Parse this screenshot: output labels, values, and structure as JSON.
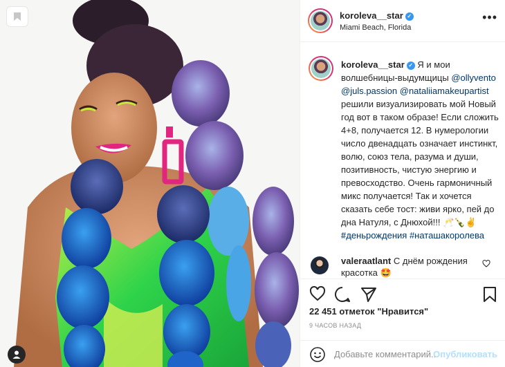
{
  "post": {
    "username": "koroleva__star",
    "location": "Miami Beach, Florida",
    "more_icon": "more-horizontal-icon"
  },
  "caption": {
    "username": "koroleva__star",
    "text_before": "Я и мои волшебницы-выдумщицы",
    "mentions": [
      "@ollyvento",
      "@juls.passion",
      "@nataliiamakeupartist"
    ],
    "text_after": "решили визуализировать мой Новый год вот в таком образе! Если сложить 4+8, получается 12. В нумерологии число двенадцать означает инстинкт, волю, союз тела, разума и души, позитивность, чистую энергию и превосходство. Очень гармоничный микс получается! Так и хочется сказать себе тост: живи ярко, пей до дна Натуля, с Днюхой!!! 🥂🍾✌",
    "hashtags": [
      "#деньрождения",
      "#наташакоролева"
    ],
    "time_ago": "9 ч."
  },
  "comment": {
    "username": "valeraatlant",
    "text": "С днём рождения красотка 🤩"
  },
  "likes_text": "22 451 отметок \"Нравится\"",
  "posted_ago": "9 ЧАСОВ НАЗАД",
  "add_comment": {
    "placeholder": "Добавьте комментарий...",
    "publish_label": "Опубликовать"
  },
  "icons": [
    "bookmark-badge-icon",
    "user-tag-icon",
    "heart-icon",
    "comment-icon",
    "share-icon",
    "save-icon",
    "emoji-icon",
    "verified-icon"
  ],
  "colors": {
    "verified": "#3897f0",
    "link": "#00376b",
    "muted": "#8e8e8e",
    "publish_disabled": "#b2dffc",
    "border": "#efefef"
  }
}
